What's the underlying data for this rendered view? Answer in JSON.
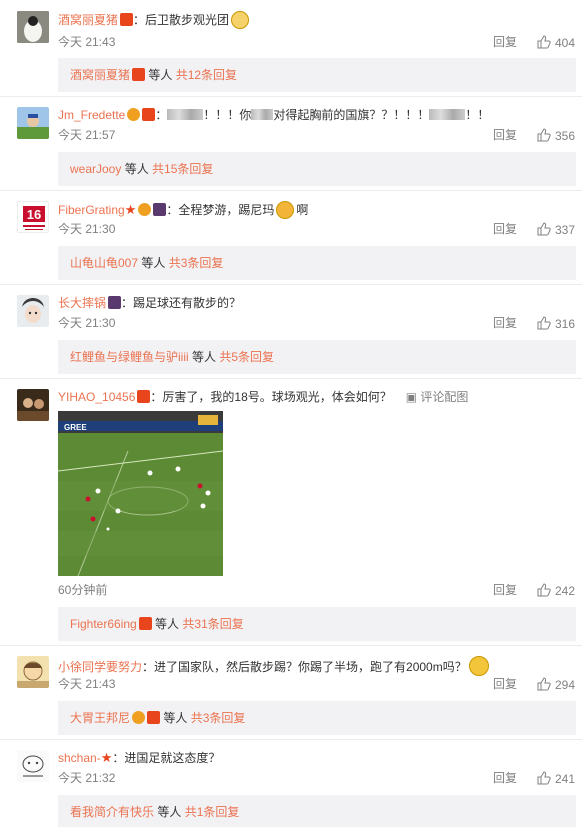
{
  "comments": [
    {
      "username": "酒窝丽夏猪",
      "text": "：后卫散步观光团",
      "time": "今天 21:43",
      "likes": "404",
      "reply_label": "回复",
      "sub": {
        "user": "酒窝丽夏猪",
        "text": " 等人 ",
        "count": "共12条回复"
      }
    },
    {
      "username": "Jm_Fredette",
      "text_pre": "：",
      "text_mid1": "！！！你",
      "text_mid2": "对得起胸前的国旗？？！！！",
      "text_end": "！！",
      "time": "今天 21:57",
      "likes": "356",
      "reply_label": "回复",
      "sub": {
        "user": "wearJooy",
        "text": " 等人 ",
        "count": "共15条回复"
      }
    },
    {
      "username": "FiberGrating",
      "text": "：全程梦游，踢尼玛",
      "text_end": "啊",
      "time": "今天 21:30",
      "likes": "337",
      "reply_label": "回复",
      "sub": {
        "user": "山龟山龟007",
        "text": " 等人 ",
        "count": "共3条回复"
      }
    },
    {
      "username": "长大摔锅",
      "text": "：踢足球还有散步的？",
      "time": "今天 21:30",
      "likes": "316",
      "reply_label": "回复",
      "sub": {
        "user": "红鲤鱼与绿鲤鱼与驴iiii",
        "text": " 等人 ",
        "count": "共5条回复"
      }
    },
    {
      "username": "YIHAO_10456",
      "text": "：厉害了，我的18号。球场观光，体会如何？",
      "pic_label": "评论配图",
      "time": "60分钟前",
      "likes": "242",
      "reply_label": "回复",
      "sub": {
        "user": "Fighter66ing",
        "text": " 等人 ",
        "count": "共31条回复"
      }
    },
    {
      "username": "小徐同学要努力",
      "text": "：进了国家队，然后散步踢？你踢了半场，跑了有2000m吗？",
      "time": "今天 21:43",
      "likes": "294",
      "reply_label": "回复",
      "sub": {
        "user": "大胃王邦尼",
        "text": " 等人 ",
        "count": "共3条回复"
      }
    },
    {
      "username": "shchan-",
      "text": "：进国足就这态度？",
      "time": "今天 21:32",
      "likes": "241",
      "reply_label": "回复",
      "sub": {
        "user": "看我简介有快乐",
        "text": " 等人 ",
        "count": "共1条回复"
      }
    }
  ],
  "avatars": {
    "fibergrating_text": "16"
  },
  "colors": {
    "username": "#eb7350",
    "meta": "#808080",
    "subbox_bg": "#f2f2f5",
    "badge_red": "#e8451d"
  }
}
